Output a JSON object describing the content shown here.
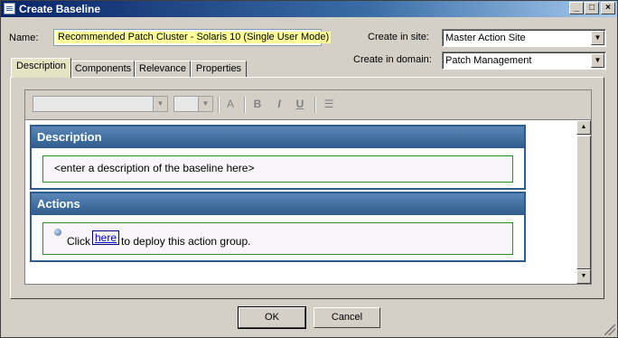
{
  "window": {
    "title": "Create Baseline"
  },
  "form": {
    "name_label": "Name:",
    "name_value": "Recommended Patch Cluster - Solaris 10 (Single User Mode)",
    "site_label": "Create in site:",
    "site_value": "Master Action Site",
    "domain_label": "Create in domain:",
    "domain_value": "Patch Management"
  },
  "tabs": [
    {
      "label": "Description",
      "active": true
    },
    {
      "label": "Components",
      "active": false
    },
    {
      "label": "Relevance",
      "active": false
    },
    {
      "label": "Properties",
      "active": false
    }
  ],
  "editor": {
    "description_heading": "Description",
    "description_placeholder": "<enter a description of the baseline here>",
    "actions_heading": "Actions",
    "action_prefix": "Click",
    "action_link": "here",
    "action_suffix": "to deploy this action group."
  },
  "buttons": {
    "ok": "OK",
    "cancel": "Cancel"
  },
  "colors": {
    "title_bar": "#0a246a",
    "section_header": "#2f5c8a",
    "body_border": "#2e8b2e",
    "name_highlight": "#ffff99",
    "active_tab": "#e6e3c4"
  }
}
